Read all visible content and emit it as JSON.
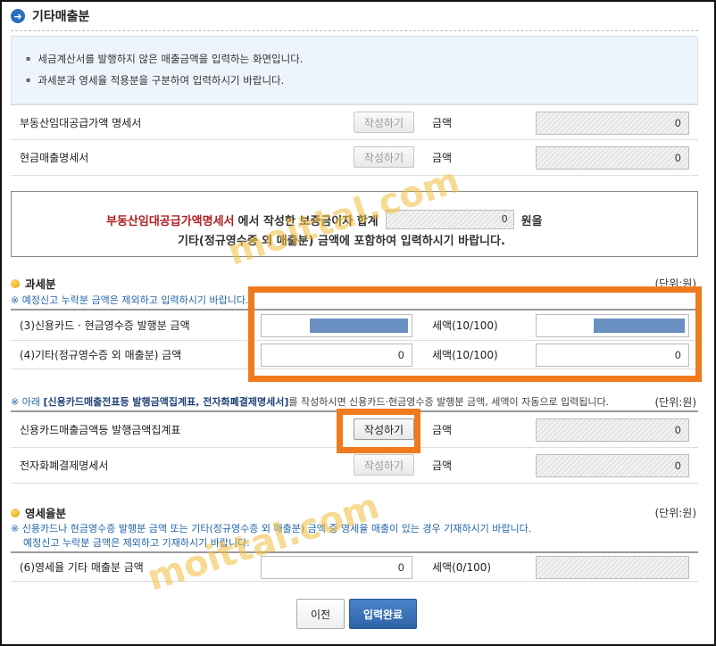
{
  "title": "기타매출분",
  "notice": [
    "세금계산서를 발행하지 않은 매출금액을 입력하는 화면입니다.",
    "과세분과 영세율 적용분을 구분하여 입력하시기 바랍니다."
  ],
  "top_rows": [
    {
      "label": "부동산임대공급가액 명세서",
      "button": "작성하기",
      "amount_label": "금액",
      "amount": "0"
    },
    {
      "label": "현금매출명세서",
      "button": "작성하기",
      "amount_label": "금액",
      "amount": "0"
    }
  ],
  "info": {
    "line1_red": "부동산임대공급가액명세서",
    "line1_mid": "에서 작성한 보증금이자 합계",
    "amount": "0",
    "line1_end": "원을",
    "line2": "기타(정규영수증 외 매출분) 금액에 포함하여 입력하시기 바랍니다."
  },
  "taxable": {
    "heading": "과세분",
    "unit": "(단위:원)",
    "note": "※ 예정신고 누락분 금액은 제외하고 입력하시기 바랍니다.",
    "rows": [
      {
        "label": "(3)신용카드 · 현금영수증 발행분 금액",
        "tax_label": "세액(10/100)",
        "amount": "",
        "tax": ""
      },
      {
        "label": "(4)기타(정규영수증 외 매출분) 금액",
        "tax_label": "세액(10/100)",
        "amount": "0",
        "tax": "0"
      }
    ]
  },
  "card_note": {
    "prefix": "※ 아래 ",
    "bold": "[신용카드매출전표등 발행금액집계표, 전자화폐결제명세서]",
    "suffix": "를 작성하시면 신용카드·현금영수증 발행분 금액, 세액이 자동으로 입력됩니다.",
    "unit": "(단위:원)"
  },
  "card_rows": [
    {
      "label": "신용카드매출금액등 발행금액집계표",
      "button": "작성하기",
      "amount_label": "금액",
      "amount": "0"
    },
    {
      "label": "전자화폐결제명세서",
      "button": "작성하기",
      "amount_label": "금액",
      "amount": "0"
    }
  ],
  "zero_rate": {
    "heading": "영세율분",
    "unit": "(단위:원)",
    "note1": "※ 신용카드나 현금영수증 발행분 금액 또는 기타(정규영수증 외 매출분) 금액 중 영세율 매출이 있는 경우 기재하시기 바랍니다.",
    "note2": "예정신고 누락분 금액은 제외하고 기재하시기 바랍니다.",
    "row": {
      "label": "(6)영세율 기타 매출분 금액",
      "amount": "0",
      "tax_label": "세액(0/100)",
      "tax": ""
    }
  },
  "buttons": {
    "prev": "이전",
    "done": "입력완료"
  },
  "watermark": "moittal.com",
  "colors": {
    "highlight": "#f07a1e",
    "primary": "#2e62a8",
    "red": "#b02020"
  }
}
